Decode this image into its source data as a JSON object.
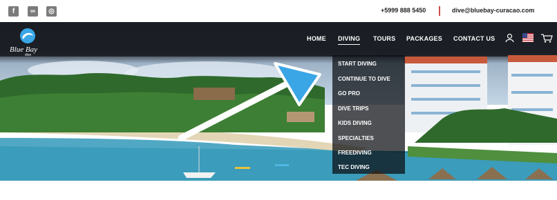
{
  "topbar": {
    "social": [
      {
        "name": "facebook",
        "glyph": "f"
      },
      {
        "name": "tripadvisor",
        "glyph": "∞"
      },
      {
        "name": "instagram",
        "glyph": "◎"
      }
    ],
    "phone": "+5999 888 5450",
    "email": "dive@bluebay-curacao.com"
  },
  "logo": {
    "text": "Blue Bay",
    "sub": "dive"
  },
  "nav": {
    "items": [
      "HOME",
      "DIVING",
      "TOURS",
      "PACKAGES",
      "CONTACT US"
    ],
    "active": "DIVING"
  },
  "diving_menu": {
    "items": [
      "START DIVING",
      "CONTINUE TO DIVE",
      "GO PRO",
      "DIVE TRIPS",
      "KIDS DIVING",
      "SPECIALTIES",
      "FREEDIVING",
      "TEC DIVING"
    ]
  },
  "colors": {
    "accent_cyan": "#3aa6e6",
    "arrow": "#ffffff",
    "separator": "#d04b4b"
  }
}
